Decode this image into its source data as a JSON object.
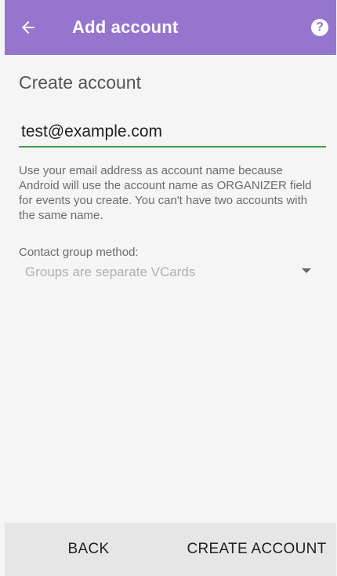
{
  "appbar": {
    "title": "Add account",
    "back_icon": "arrow-left-icon",
    "help_icon": "help-circle-icon",
    "help_glyph": "?",
    "color": "#9575cd"
  },
  "form": {
    "section_title": "Create account",
    "email_value": "test@example.com",
    "help_text": "Use your email address as account name because Android will use the account name as ORGANIZER field for events you create. You can't have two accounts with the same name.",
    "group_label": "Contact group method:",
    "group_selected": "Groups are separate VCards",
    "accent_color": "#43a047"
  },
  "footer": {
    "back_label": "BACK",
    "create_label": "CREATE ACCOUNT"
  }
}
